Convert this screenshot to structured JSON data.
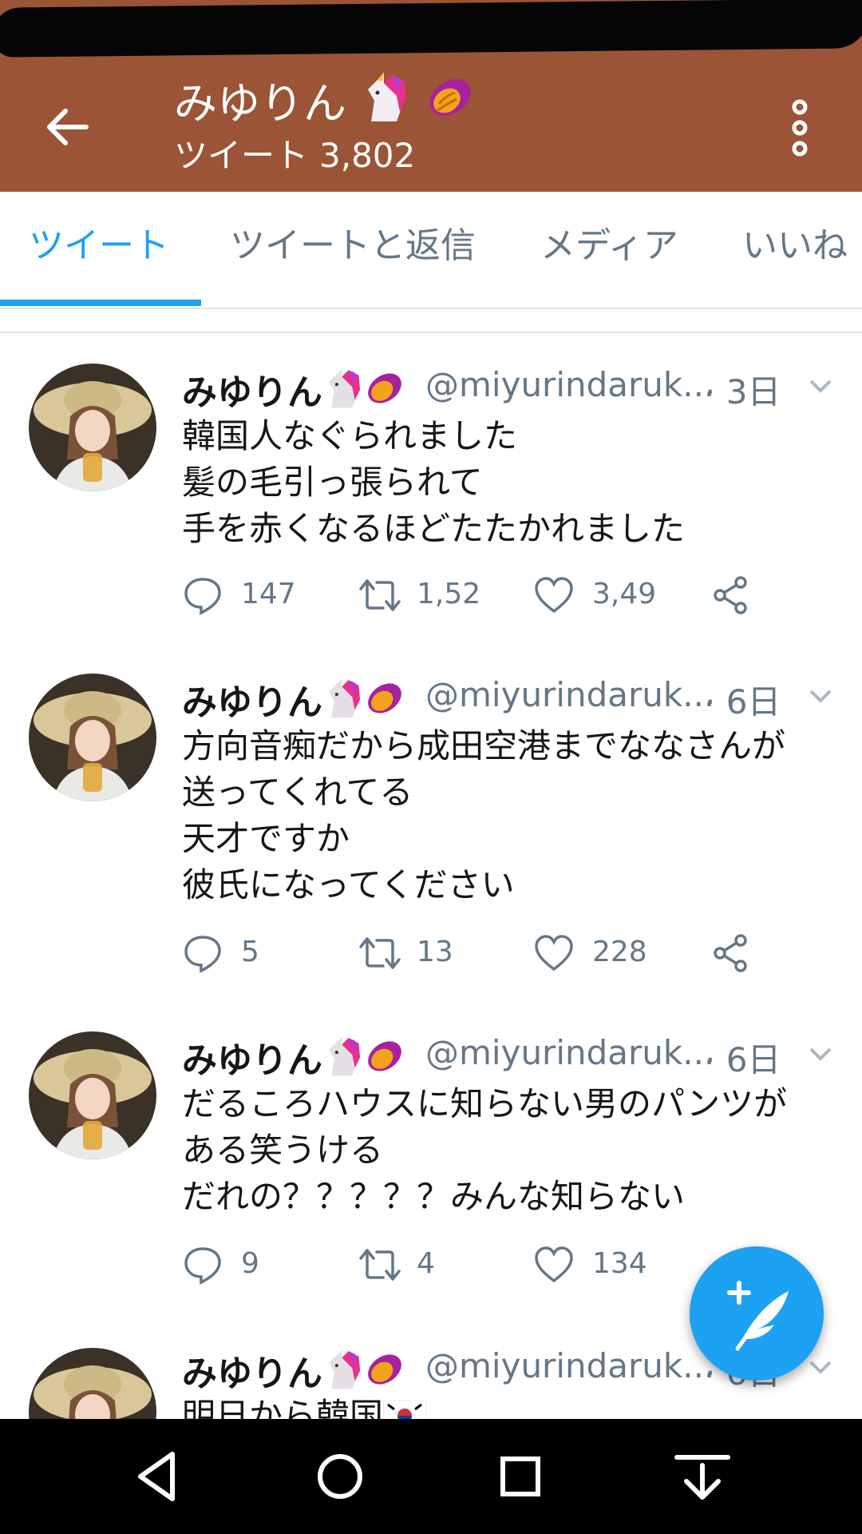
{
  "colors": {
    "header_bg": "#9b5435",
    "accent": "#1da1f2",
    "text_primary": "#14171a",
    "text_secondary": "#657786",
    "divider": "#e1e8ed"
  },
  "header": {
    "name": "みゆりん",
    "tweets_label": "ツイート",
    "tweets_count": "3,802",
    "back_icon": "arrow-left-icon",
    "menu_icon": "more-vert-icon"
  },
  "tabs": [
    {
      "label": "ツイート",
      "active": true
    },
    {
      "label": "ツイートと返信",
      "active": false
    },
    {
      "label": "メディア",
      "active": false
    },
    {
      "label": "いいね",
      "active": false
    }
  ],
  "tweets": [
    {
      "name": "みゆりん",
      "handle": "@miyurindaruk...",
      "time": "· 3日",
      "lines": [
        "韓国人なぐられました",
        "髪の毛引っ張られて",
        "手を赤くなるほどたたかれました"
      ],
      "replies": "147",
      "retweets": "1,52",
      "likes": "3,49"
    },
    {
      "name": "みゆりん",
      "handle": "@miyurindaruk...",
      "time": "· 6日",
      "lines": [
        "方向音痴だから成田空港までななさんが",
        "送ってくれてる",
        "天才ですか",
        "彼氏になってください"
      ],
      "replies": "5",
      "retweets": "13",
      "likes": "228"
    },
    {
      "name": "みゆりん",
      "handle": "@miyurindaruk...",
      "time": "· 6日",
      "lines": [
        "だるころハウスに知らない男のパンツが",
        "ある笑うける",
        "だれの？？？？？みんな知らない"
      ],
      "replies": "9",
      "retweets": "4",
      "likes": "134"
    },
    {
      "name": "みゆりん",
      "handle": "@miyurindaruk...",
      "time": "· 6日",
      "lines": [
        "明日から韓国"
      ]
    }
  ],
  "fab": {
    "icon": "compose-tweet-icon"
  },
  "navbar": {
    "icons": [
      "nav-back-icon",
      "nav-home-icon",
      "nav-recents-icon",
      "nav-notification-pull-icon"
    ]
  }
}
